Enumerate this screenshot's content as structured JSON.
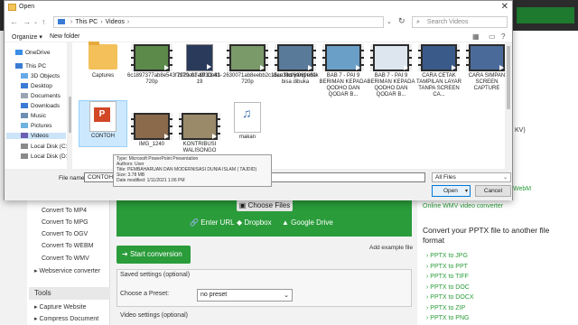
{
  "dialog": {
    "title": "Open",
    "path": [
      "This PC",
      "Videos"
    ],
    "search_placeholder": "Search Videos",
    "organize": "Organize ▾",
    "new_folder": "New folder",
    "nav": [
      {
        "label": "OneDrive",
        "color": "#3a8ee6"
      },
      {
        "label": "This PC",
        "color": "#3a7bd5"
      },
      {
        "label": "3D Objects",
        "color": "#67a9e8"
      },
      {
        "label": "Desktop",
        "color": "#3a7bd5"
      },
      {
        "label": "Documents",
        "color": "#9aa5b1"
      },
      {
        "label": "Downloads",
        "color": "#3a7bd5"
      },
      {
        "label": "Music",
        "color": "#6c8fb3"
      },
      {
        "label": "Pictures",
        "color": "#6fb3e0"
      },
      {
        "label": "Videos",
        "color": "#6b5fb3"
      },
      {
        "label": "Local Disk (C:)",
        "color": "#8a8a8a"
      },
      {
        "label": "Local Disk (D:)",
        "color": "#8a8a8a"
      }
    ],
    "files": [
      {
        "name": "Captures",
        "kind": "folder"
      },
      {
        "name": "6c1897377ab8e543f7179cb7a9f30b81-720p",
        "kind": "video",
        "color": "#5c8a4a"
      },
      {
        "name": "2021-01-19 11-43-19",
        "kind": "video",
        "color": "#2a3a5a"
      },
      {
        "name": "2630071ab8eebb2c15ce38df6f069e80-720p",
        "kind": "video",
        "color": "#7a9a6a"
      },
      {
        "name": "atau fiks yang tidak bisa dibuka",
        "kind": "video",
        "color": "#5a7a9a"
      },
      {
        "name": "BAB 7 - PAI 9 BERIMAN KEPADA QODHO DAN QODAR B...",
        "kind": "video",
        "color": "#6aa0c8"
      },
      {
        "name": "BAB 7 - PAI 9 BERIMAN KEPADA QODHO DAN QODAR B...",
        "kind": "video",
        "color": "#dde6ef"
      },
      {
        "name": "CARA CETAK TAMPILAN LAYAR TANPA SCREEN CA...",
        "kind": "video",
        "color": "#3a5a8a"
      },
      {
        "name": "CARA SIMPAN SCREEN CAPTURE",
        "kind": "video",
        "color": "#4a6a9a"
      },
      {
        "name": "CONTOH",
        "kind": "ppt"
      },
      {
        "name": "IMG_1240",
        "kind": "video",
        "color": "#8a6a4a"
      },
      {
        "name": "KONTRIBUSI WALISONGO",
        "kind": "video",
        "color": "#9a8a6a"
      },
      {
        "name": "makan",
        "kind": "audio"
      }
    ],
    "tooltip": [
      "Type: Microsoft PowerPoint Presentation",
      "Authors: User",
      "Title: PEMBAHARUAN DAN MODERNISASI DUNIA ISLAM ( TAJDID)",
      "Size: 3.78 MB",
      "Date modified: 1/11/2021 1:06 PM"
    ],
    "file_name_label": "File name:",
    "file_name_value": "CONTOH",
    "filter": "All Files",
    "open": "Open",
    "cancel": "Cancel"
  },
  "page": {
    "left_links": [
      "Convert To MP4",
      "Convert To MPG",
      "Convert To OGV",
      "Convert To WEBM",
      "Convert To WMV"
    ],
    "webservice": "Webservice converter",
    "tools_heading": "Tools",
    "tools": [
      "Capture Website",
      "Compress Document"
    ],
    "choose_files": "Choose Files",
    "enter_url": "Enter URL",
    "dropbox": "Dropbox",
    "google_drive": "Google Drive",
    "start": "Start conversion",
    "add_example": "Add example file",
    "saved_settings": "Saved settings (optional)",
    "choose_preset": "Choose a Preset:",
    "preset_value": "no preset",
    "video_settings": "Video settings (optional)",
    "right_frag1": "KV)",
    "right_frag2": "WebM",
    "online_wmv": "Online WMV video converter",
    "convert_heading": "Convert your PPTX file to another file format",
    "pptx_links": [
      "PPTX to JPG",
      "PPTX to PPT",
      "PPTX to TIFF",
      "PPTX to DOC",
      "PPTX to DOCX",
      "PPTX to ZIP",
      "PPTX to PNG"
    ]
  }
}
